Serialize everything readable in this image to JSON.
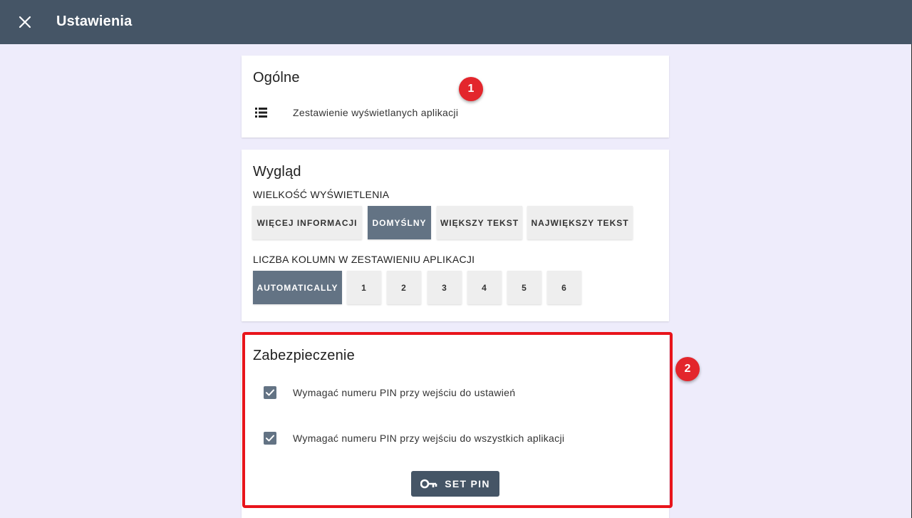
{
  "appbar": {
    "title": "Ustawienia",
    "close_icon": "close-icon",
    "color": "#455566"
  },
  "general": {
    "title": "Ogólne",
    "row_icon": "list-icon",
    "row_label": "Zestawienie wyświetlanych aplikacji"
  },
  "appearance": {
    "title": "Wygląd",
    "display_size_label": "WIELKOŚĆ WYŚWIETLENIA",
    "display_size_options": [
      "WIĘCEJ INFORMACJI",
      "DOMYŚLNY",
      "WIĘKSZY TEKST",
      "NAJWIĘKSZY TEKST"
    ],
    "display_size_selected": "DOMYŚLNY",
    "columns_label": "LICZBA KOLUMN W ZESTAWIENIU APLIKACJI",
    "columns_options": [
      "AUTOMATICALLY",
      "1",
      "2",
      "3",
      "4",
      "5",
      "6"
    ],
    "columns_selected": "AUTOMATICALLY"
  },
  "security": {
    "title": "Zabezpieczenie",
    "options": [
      {
        "label": "Wymagać numeru PIN przy wejściu do ustawień",
        "checked": true
      },
      {
        "label": "Wymagać numeru PIN przy wejściu do wszystkich aplikacji",
        "checked": true
      }
    ],
    "set_pin_label": "SET PIN",
    "set_pin_icon": "key-icon"
  },
  "annotations": {
    "badge_1": "1",
    "badge_2": "2",
    "highlight_color": "#e8141b"
  },
  "colors": {
    "background": "#eeecfb",
    "selected_button": "#637384",
    "button": "#eeeeee"
  }
}
